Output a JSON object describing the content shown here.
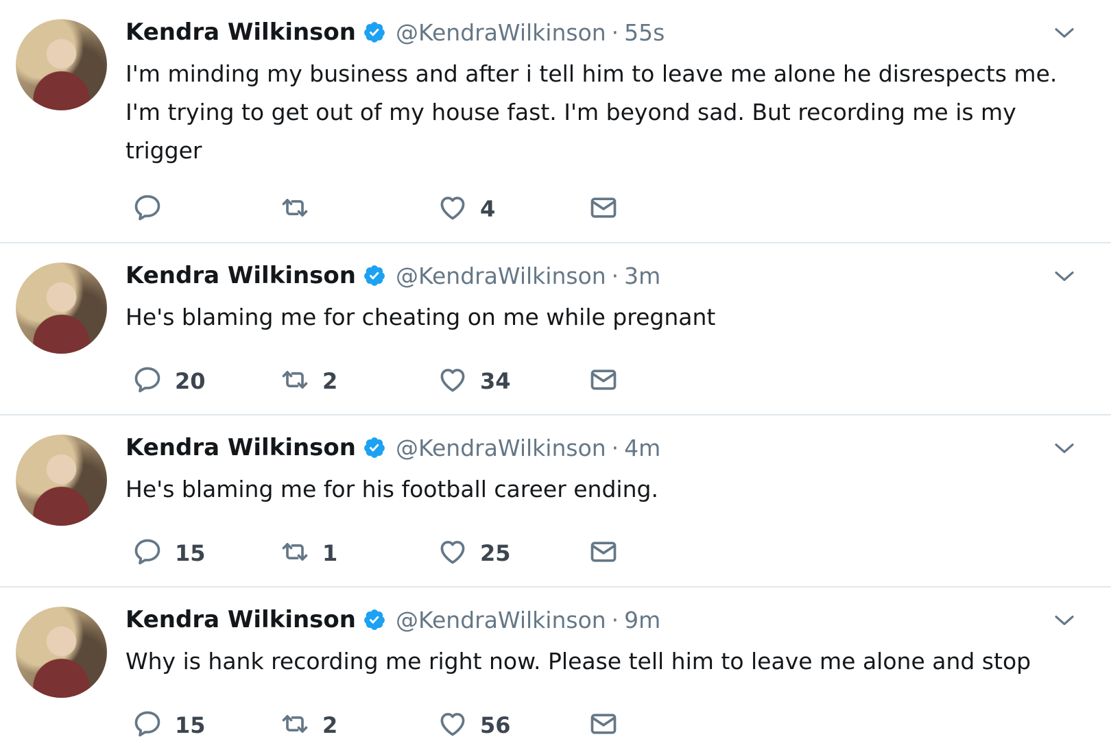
{
  "tweets": [
    {
      "name": "Kendra Wilkinson",
      "handle": "@KendraWilkinson",
      "separator": "·",
      "time": "55s",
      "text": "I'm minding my business and after i tell him to leave me alone he disrespects me. I'm trying to get out of my house fast. I'm beyond sad. But recording me is my trigger",
      "replies": "",
      "retweets": "",
      "likes": "4"
    },
    {
      "name": "Kendra Wilkinson",
      "handle": "@KendraWilkinson",
      "separator": "·",
      "time": "3m",
      "text": "He's blaming me for cheating on me while pregnant",
      "replies": "20",
      "retweets": "2",
      "likes": "34"
    },
    {
      "name": "Kendra Wilkinson",
      "handle": "@KendraWilkinson",
      "separator": "·",
      "time": "4m",
      "text": "He's blaming me for his football career ending.",
      "replies": "15",
      "retweets": "1",
      "likes": "25"
    },
    {
      "name": "Kendra Wilkinson",
      "handle": "@KendraWilkinson",
      "separator": "·",
      "time": "9m",
      "text": "Why is hank recording me right now. Please tell him to leave me alone and stop",
      "replies": "15",
      "retweets": "2",
      "likes": "56"
    }
  ],
  "icons": {
    "verified": "verified-badge-icon",
    "chevron": "chevron-down-icon",
    "reply": "reply-icon",
    "retweet": "retweet-icon",
    "like": "heart-icon",
    "dm": "envelope-icon"
  },
  "colors": {
    "verified": "#1da1f2",
    "icon_gray": "#657786",
    "text": "#14171a",
    "divider": "#e1e8ed"
  }
}
